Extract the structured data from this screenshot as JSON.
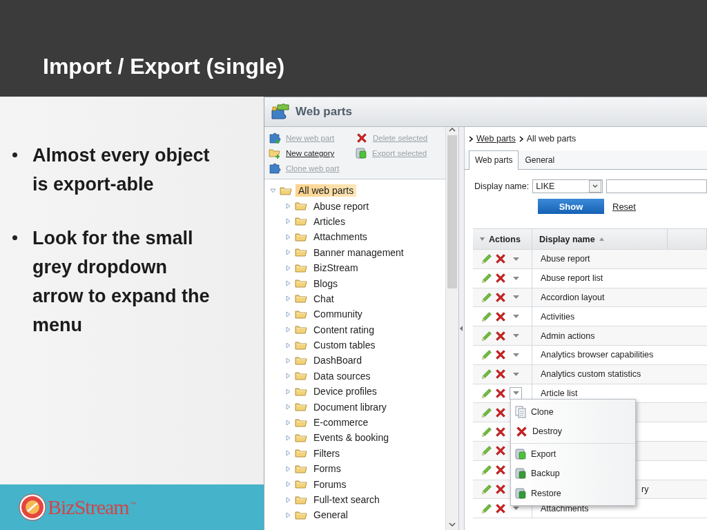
{
  "slide": {
    "title": "Import / Export (single)",
    "bullets": [
      "Almost every object is export-able",
      "Look for the small grey dropdown arrow to expand the menu"
    ],
    "logo": {
      "name": "BizStream",
      "trademark": "™"
    }
  },
  "app": {
    "header": {
      "title": "Web parts"
    },
    "actions": [
      {
        "label": "New web part",
        "disabled": true,
        "kind": "new-part"
      },
      {
        "label": "Delete selected",
        "disabled": true,
        "kind": "delete"
      },
      {
        "label": "New category",
        "disabled": false,
        "kind": "new-category"
      },
      {
        "label": "Export selected",
        "disabled": true,
        "kind": "export"
      },
      {
        "label": "Clone web part",
        "disabled": true,
        "kind": "clone"
      }
    ],
    "tree": {
      "label": "All web parts",
      "selected": true,
      "expanded": true,
      "children": [
        {
          "label": "Abuse report",
          "selected": false,
          "expanded": false
        },
        {
          "label": "Articles",
          "selected": false,
          "expanded": false
        },
        {
          "label": "Attachments",
          "selected": false,
          "expanded": false
        },
        {
          "label": "Banner management",
          "selected": false,
          "expanded": false
        },
        {
          "label": "BizStream",
          "selected": false,
          "expanded": false
        },
        {
          "label": "Blogs",
          "selected": false,
          "expanded": false
        },
        {
          "label": "Chat",
          "selected": false,
          "expanded": false
        },
        {
          "label": "Community",
          "selected": false,
          "expanded": false
        },
        {
          "label": "Content rating",
          "selected": false,
          "expanded": false
        },
        {
          "label": "Custom tables",
          "selected": false,
          "expanded": false
        },
        {
          "label": "DashBoard",
          "selected": false,
          "expanded": false
        },
        {
          "label": "Data sources",
          "selected": false,
          "expanded": false
        },
        {
          "label": "Device profiles",
          "selected": false,
          "expanded": false
        },
        {
          "label": "Document library",
          "selected": false,
          "expanded": false
        },
        {
          "label": "E-commerce",
          "selected": false,
          "expanded": false
        },
        {
          "label": "Events & booking",
          "selected": false,
          "expanded": false
        },
        {
          "label": "Filters",
          "selected": false,
          "expanded": false
        },
        {
          "label": "Forms",
          "selected": false,
          "expanded": false
        },
        {
          "label": "Forums",
          "selected": false,
          "expanded": false
        },
        {
          "label": "Full-text search",
          "selected": false,
          "expanded": false
        },
        {
          "label": "General",
          "selected": false,
          "expanded": false
        }
      ]
    },
    "breadcrumb": [
      {
        "label": "Web parts",
        "link": true
      },
      {
        "label": "All web parts",
        "link": false
      }
    ],
    "tabs": [
      {
        "label": "Web parts",
        "selected": true
      },
      {
        "label": "General",
        "selected": false
      }
    ],
    "filter": {
      "label": "Display name:",
      "operator": "LIKE",
      "show_button": "Show",
      "reset_link": "Reset"
    },
    "table": {
      "columns": [
        {
          "label": "Actions"
        },
        {
          "label": "Display name",
          "sorted": true
        }
      ],
      "rows": [
        {
          "name": "Abuse report",
          "menu_open": false
        },
        {
          "name": "Abuse report list",
          "menu_open": false
        },
        {
          "name": "Accordion layout",
          "menu_open": false
        },
        {
          "name": "Activities",
          "menu_open": false
        },
        {
          "name": "Admin actions",
          "menu_open": false
        },
        {
          "name": "Analytics browser capabilities",
          "menu_open": false
        },
        {
          "name": "Analytics custom statistics",
          "menu_open": false
        },
        {
          "name": "Article list",
          "menu_open": true
        },
        {
          "covered": true
        },
        {
          "covered": true
        },
        {
          "covered": true
        },
        {
          "covered": true
        },
        {
          "name": "ry",
          "covered": true
        },
        {
          "name": "Attachments",
          "menu_open": false
        }
      ]
    },
    "context_menu": {
      "items": [
        {
          "label": "Clone",
          "kind": "clone",
          "separator_before": false
        },
        {
          "label": "Destroy",
          "kind": "destroy",
          "separator_before": false
        },
        {
          "label": "Export",
          "kind": "export",
          "separator_before": true
        },
        {
          "label": "Backup",
          "kind": "backup",
          "separator_before": false
        },
        {
          "label": "Restore",
          "kind": "restore",
          "separator_before": false
        }
      ]
    }
  }
}
